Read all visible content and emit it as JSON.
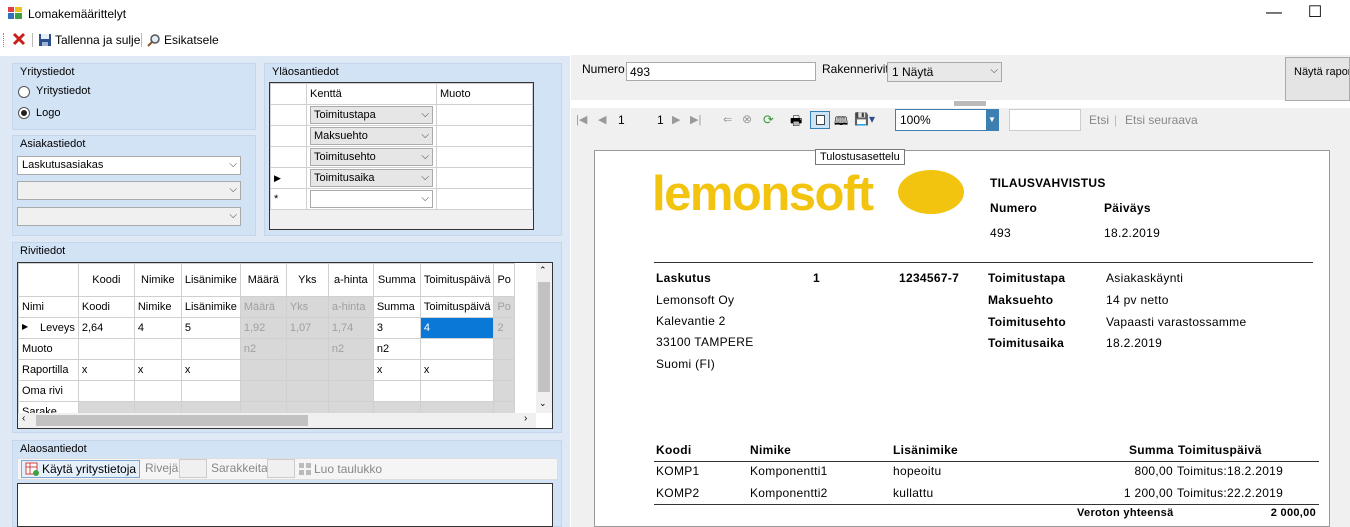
{
  "window": {
    "title": "Lomakemäärittelyt",
    "minimize": "—",
    "maximize": "☐"
  },
  "toolbar": {
    "save_close": "Tallenna ja sulje",
    "preview": "Esikatsele"
  },
  "yritystiedot": {
    "label": "Yritystiedot",
    "options": [
      "Yritystiedot",
      "Logo"
    ],
    "selected": "Logo"
  },
  "asiakastiedot": {
    "label": "Asiakastiedot",
    "select1": "Laskutusasiakas",
    "select2": "",
    "select3": ""
  },
  "ylaosantiedot": {
    "label": "Yläosantiedot",
    "headers": [
      "Kenttä",
      "Muoto"
    ],
    "rows": [
      "Toimitustapa",
      "Maksuehto",
      "Toimitusehto",
      "Toimitusaika"
    ],
    "new_row_marker": "*"
  },
  "rivitiedot": {
    "label": "Rivitiedot",
    "headers": [
      "",
      "Koodi",
      "Nimike",
      "Lisänimike",
      "Määrä",
      "Yks",
      "a-hinta",
      "Summa",
      "Toimituspäivä",
      "Po"
    ],
    "rows": [
      [
        "Nimi",
        "Koodi",
        "Nimike",
        "Lisänimike",
        "Määrä",
        "Yks",
        "a-hinta",
        "Summa",
        "Toimituspäivä",
        "Po"
      ],
      [
        "Leveys",
        "2,64",
        "4",
        "5",
        "1,92",
        "1,07",
        "1,74",
        "3",
        "4",
        "2"
      ],
      [
        "Muoto",
        "",
        "",
        "",
        "n2",
        "",
        "n2",
        "n2",
        "",
        ""
      ],
      [
        "Raportilla",
        "x",
        "x",
        "x",
        "",
        "",
        "",
        "x",
        "x",
        ""
      ],
      [
        "Oma rivi",
        "",
        "",
        "",
        "",
        "",
        "",
        "",
        "",
        ""
      ],
      [
        "Sarake",
        "",
        "",
        "",
        "",
        "",
        "",
        "",
        "",
        ""
      ]
    ]
  },
  "alaosantiedot": {
    "label": "Alaosantiedot",
    "use_company": "Käytä yritystietoja",
    "rows_label": "Rivejä",
    "cols_label": "Sarakkeita",
    "create_table": "Luo taulukko"
  },
  "report_params": {
    "numero_label": "Numero",
    "numero_value": "493",
    "rakennerivit_label": "Rakennerivit",
    "rakennerivit_value": "1 Näytä",
    "show_report": "Näytä raport"
  },
  "viewer_toolbar": {
    "page": "1",
    "total": "1",
    "zoom": "100%",
    "find": "Etsi",
    "find_next": "Etsi seuraava",
    "tooltip": "Tulostusasettelu"
  },
  "report": {
    "logo_text": "lemonsoft",
    "doc_title": "TILAUSVAHVISTUS",
    "numero_label": "Numero",
    "paivays_label": "Päiväys",
    "numero": "493",
    "paivays": "18.2.2019",
    "billing": {
      "label": "Laskutus",
      "num": "1",
      "id": "1234567-7",
      "lines": [
        "Lemonsoft Oy",
        "Kalevantie 2",
        "33100  TAMPERE",
        "Suomi (FI)"
      ]
    },
    "terms": [
      {
        "label": "Toimitustapa",
        "value": "Asiakaskäynti"
      },
      {
        "label": "Maksuehto",
        "value": "14 pv netto"
      },
      {
        "label": "Toimitusehto",
        "value": "Vapaasti varastossamme"
      },
      {
        "label": "Toimitusaika",
        "value": "18.2.2019"
      }
    ],
    "table_headers": [
      "Koodi",
      "Nimike",
      "Lisänimike",
      "Summa",
      "Toimituspäivä"
    ],
    "table_rows": [
      {
        "koodi": "KOMP1",
        "nimike": "Komponentti1",
        "lisa": "hopeoitu",
        "summa": "800,00",
        "tp": "Toimitus:18.2.2019"
      },
      {
        "koodi": "KOMP2",
        "nimike": "Komponentti2",
        "lisa": "kullattu",
        "summa": "1 200,00",
        "tp": "Toimitus:22.2.2019"
      }
    ],
    "total_label": "Veroton yhteensä",
    "total_value": "2 000,00"
  }
}
